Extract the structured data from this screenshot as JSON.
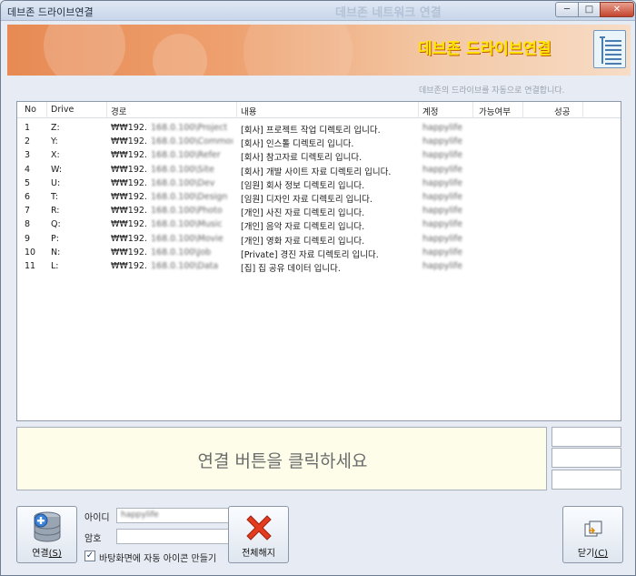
{
  "window": {
    "title": "데브존 드라이브연결",
    "ghost_title": "데브존 네트워크 연결",
    "min_label": "─",
    "max_label": "□",
    "close_label": "✕"
  },
  "banner": {
    "title": "데브존 드라이브연결",
    "subtext": "데브존의 드라이브를 자동으로 연결합니다."
  },
  "table": {
    "headers": [
      "No",
      "Drive",
      "경로",
      "내용",
      "계정",
      "가능여부",
      "성공"
    ],
    "rows": [
      {
        "no": "1",
        "drive": "Z:",
        "path": "₩₩192.",
        "path_blur": "168.0.100\\Project",
        "content": "[회사] 프로젝트 작업 디렉토리 입니다.",
        "account": "happylife"
      },
      {
        "no": "2",
        "drive": "Y:",
        "path": "₩₩192.",
        "path_blur": "168.0.100\\Common",
        "content": "[회사] 인스톨 디렉토리 입니다.",
        "account": "happylife"
      },
      {
        "no": "3",
        "drive": "X:",
        "path": "₩₩192.",
        "path_blur": "168.0.100\\Refer",
        "content": "[회사] 참고자료 디렉토리 입니다.",
        "account": "happylife"
      },
      {
        "no": "4",
        "drive": "W:",
        "path": "₩₩192.",
        "path_blur": "168.0.100\\Site",
        "content": "[회사] 개발 사이트 자료 디렉토리 입니다.",
        "account": "happylife"
      },
      {
        "no": "5",
        "drive": "U:",
        "path": "₩₩192.",
        "path_blur": "168.0.100\\Dev",
        "content": "[임원] 회사 정보 디렉토리 입니다.",
        "account": "happylife"
      },
      {
        "no": "6",
        "drive": "T:",
        "path": "₩₩192.",
        "path_blur": "168.0.100\\Design",
        "content": "[임원] 디자인 자료 디렉토리 입니다.",
        "account": "happylife"
      },
      {
        "no": "7",
        "drive": "R:",
        "path": "₩₩192.",
        "path_blur": "168.0.100\\Photo",
        "content": "[개인] 사진 자료 디렉토리 입니다.",
        "account": "happylife"
      },
      {
        "no": "8",
        "drive": "Q:",
        "path": "₩₩192.",
        "path_blur": "168.0.100\\Music",
        "content": "[개인] 음악 자료 디렉토리 입니다.",
        "account": "happylife"
      },
      {
        "no": "9",
        "drive": "P:",
        "path": "₩₩192.",
        "path_blur": "168.0.100\\Movie",
        "content": "[개인] 영화 자료 디렉토리 입니다.",
        "account": "happylife"
      },
      {
        "no": "10",
        "drive": "N:",
        "path": "₩₩192.",
        "path_blur": "168.0.100\\Job",
        "content": "[Private] 경진 자료 디렉토리 입니다.",
        "account": "happylife"
      },
      {
        "no": "11",
        "drive": "L:",
        "path": "₩₩192.",
        "path_blur": "168.0.100\\Data",
        "content": "[집] 집 공유 데이터 입니다.",
        "account": "happylife"
      }
    ]
  },
  "message": {
    "text": "연결 버튼을 클릭하세요"
  },
  "form": {
    "id_label": "아이디",
    "id_value": "happylife",
    "password_label": "암호",
    "password_value": "",
    "checkbox_label": "바탕화면에 자동 아이콘 만들기",
    "checkbox_checked": "✓"
  },
  "buttons": {
    "connect": {
      "label": "연결",
      "shortcut": "(S)",
      "icon": "database-icon"
    },
    "disconnect": {
      "label": "전체해지",
      "icon": "red-x-icon"
    },
    "close": {
      "label": "닫기",
      "shortcut": "(C)",
      "icon": "window-restore-icon"
    }
  }
}
